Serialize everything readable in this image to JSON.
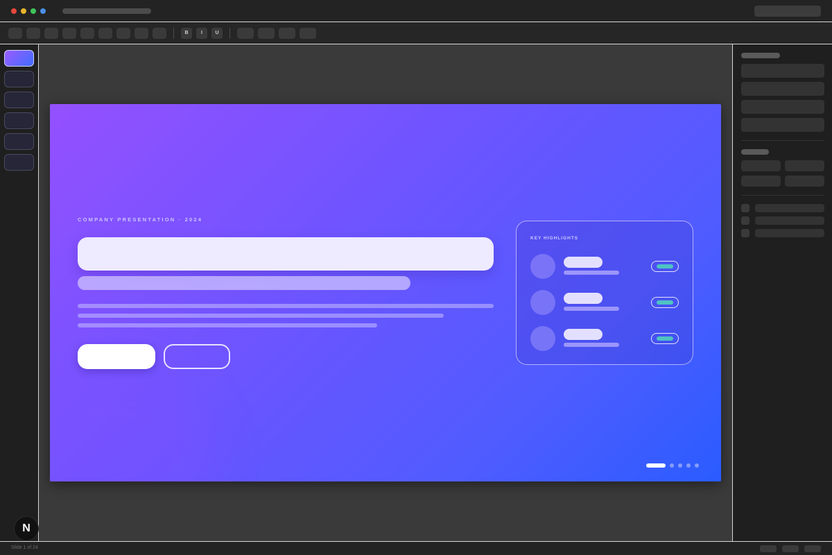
{
  "window": {
    "traffic_lights": {
      "red": "#e8473c",
      "yellow": "#e8b52c",
      "green": "#3ec35b",
      "blue": "#4a8fe8"
    }
  },
  "toolbar": {
    "format_buttons": [
      "B",
      "I",
      "U"
    ]
  },
  "slides": {
    "thumbnail_count": 6,
    "active_index": 0
  },
  "slide": {
    "eyebrow": "COMPANY PRESENTATION · 2024",
    "gradient": [
      "#9450ff",
      "#2a5cff"
    ],
    "highlights_card": {
      "title": "KEY HIGHLIGHTS",
      "items": [
        {
          "status_color": "#4fc3c3"
        },
        {
          "status_color": "#4fc3c3"
        },
        {
          "status_color": "#4fc3c3"
        }
      ]
    },
    "pagination": {
      "total": 5,
      "current": 1
    }
  },
  "statusbar": {
    "slide_counter": "Slide 1 of 24"
  },
  "badge": {
    "letter": "N"
  }
}
